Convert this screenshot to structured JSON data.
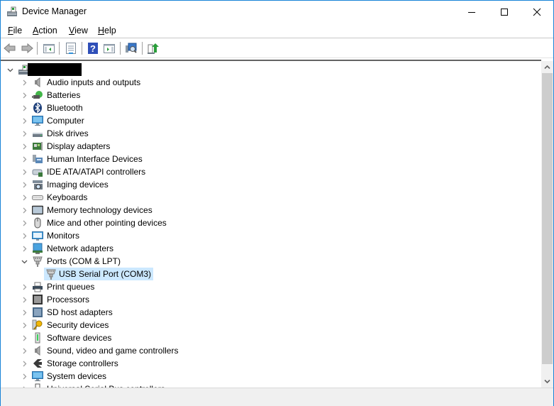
{
  "window": {
    "title": "Device Manager",
    "controls": {
      "minimize": "minimize-icon",
      "maximize": "maximize-icon",
      "close": "close-icon"
    }
  },
  "menu": {
    "items": [
      {
        "label": "File",
        "accel": "F",
        "rest": "ile"
      },
      {
        "label": "Action",
        "accel": "A",
        "rest": "ction"
      },
      {
        "label": "View",
        "accel": "V",
        "rest": "iew"
      },
      {
        "label": "Help",
        "accel": "H",
        "rest": "elp"
      }
    ]
  },
  "toolbar": {
    "buttons": [
      {
        "name": "back-button",
        "icon": "arrow-left-icon"
      },
      {
        "name": "forward-button",
        "icon": "arrow-right-icon"
      },
      {
        "name": "show-hide-console-tree-button",
        "icon": "console-tree-icon"
      },
      {
        "name": "properties-button",
        "icon": "properties-icon"
      },
      {
        "name": "help-button",
        "icon": "help-icon"
      },
      {
        "name": "show-action-pane-button",
        "icon": "action-pane-icon"
      },
      {
        "name": "scan-hardware-button",
        "icon": "scan-hardware-icon"
      },
      {
        "name": "update-driver-button",
        "icon": "update-driver-icon"
      }
    ]
  },
  "tree": {
    "root": {
      "label": "",
      "redacted": true,
      "expanded": true,
      "icon": "computer-root-icon"
    },
    "categories": [
      {
        "label": "Audio inputs and outputs",
        "icon": "speaker-icon",
        "expanded": false
      },
      {
        "label": "Batteries",
        "icon": "battery-icon",
        "expanded": false
      },
      {
        "label": "Bluetooth",
        "icon": "bluetooth-icon",
        "expanded": false
      },
      {
        "label": "Computer",
        "icon": "computer-icon",
        "expanded": false
      },
      {
        "label": "Disk drives",
        "icon": "disk-drive-icon",
        "expanded": false
      },
      {
        "label": "Display adapters",
        "icon": "display-adapter-icon",
        "expanded": false
      },
      {
        "label": "Human Interface Devices",
        "icon": "hid-icon",
        "expanded": false
      },
      {
        "label": "IDE ATA/ATAPI controllers",
        "icon": "ide-controller-icon",
        "expanded": false
      },
      {
        "label": "Imaging devices",
        "icon": "camera-icon",
        "expanded": false
      },
      {
        "label": "Keyboards",
        "icon": "keyboard-icon",
        "expanded": false
      },
      {
        "label": "Memory technology devices",
        "icon": "memory-icon",
        "expanded": false
      },
      {
        "label": "Mice and other pointing devices",
        "icon": "mouse-icon",
        "expanded": false
      },
      {
        "label": "Monitors",
        "icon": "monitor-icon",
        "expanded": false
      },
      {
        "label": "Network adapters",
        "icon": "network-adapter-icon",
        "expanded": false
      },
      {
        "label": "Ports (COM & LPT)",
        "icon": "port-icon",
        "expanded": true,
        "children": [
          {
            "label": "USB Serial Port (COM3)",
            "icon": "port-icon",
            "selected": true
          }
        ]
      },
      {
        "label": "Print queues",
        "icon": "printer-icon",
        "expanded": false
      },
      {
        "label": "Processors",
        "icon": "processor-icon",
        "expanded": false
      },
      {
        "label": "SD host adapters",
        "icon": "sd-card-icon",
        "expanded": false
      },
      {
        "label": "Security devices",
        "icon": "key-icon",
        "expanded": false
      },
      {
        "label": "Software devices",
        "icon": "software-device-icon",
        "expanded": false
      },
      {
        "label": "Sound, video and game controllers",
        "icon": "speaker-icon",
        "expanded": false
      },
      {
        "label": "Storage controllers",
        "icon": "storage-controller-icon",
        "expanded": false
      },
      {
        "label": "System devices",
        "icon": "computer-icon",
        "expanded": false
      },
      {
        "label": "Universal Serial Bus controllers",
        "icon": "usb-icon",
        "expanded": false
      }
    ]
  },
  "colors": {
    "selection": "#cce8ff",
    "window_border": "#1883d7"
  }
}
